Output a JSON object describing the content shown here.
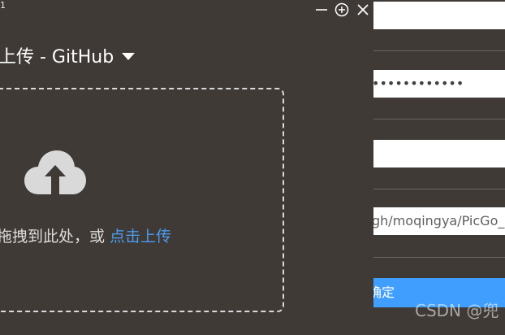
{
  "window": {
    "title_fragment": "1",
    "minimize_icon": "minimize-icon",
    "pin_icon": "pin-icon",
    "close_icon": "close-icon"
  },
  "upload": {
    "heading": "上传 - GitHub",
    "dropdown_icon": "caret-down-icon",
    "cloud_icon": "cloud-upload-icon",
    "drop_hint": "拖拽到此处，或 ",
    "drop_link": "点击上传"
  },
  "form": {
    "token_value": "••••••••••••",
    "path_value": "gh/moqingya/PicGo_S",
    "confirm_label": "确定"
  },
  "watermark": "CSDN @兜",
  "colors": {
    "background": "#3f3a36",
    "accent": "#409eff",
    "link": "#4a9bf0"
  }
}
